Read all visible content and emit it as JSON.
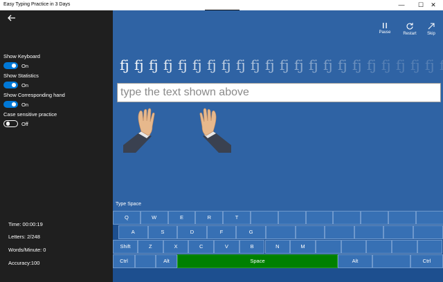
{
  "window": {
    "title": "Easy Typing Practice in 3 Days",
    "minimize": "—",
    "maximize": "☐",
    "close": "✕"
  },
  "sidebar": {
    "options": [
      {
        "label": "Show Keyboard",
        "state": "On",
        "on": true
      },
      {
        "label": "Show Statistics",
        "state": "On",
        "on": true
      },
      {
        "label": "Show Corresponding hand",
        "state": "On",
        "on": true
      },
      {
        "label": "Case sensitive practice",
        "state": "Off",
        "on": false
      }
    ],
    "stats": {
      "time": "Time: 00:00:19",
      "letters": "Letters: 2/248",
      "wpm": "Words/Minute: 0",
      "accuracy": "Accuracy:100"
    }
  },
  "toolbar": {
    "pause": "Pause",
    "restart": "Restart",
    "skip": "Skip"
  },
  "practice": {
    "words": [
      "fj",
      "fj",
      "fj",
      "fj",
      "fj",
      "fj",
      "fj",
      "fj",
      "fj",
      "fj",
      "fj",
      "fj",
      "fj",
      "fj",
      "fj",
      "fj",
      "fj",
      "fj",
      "fj",
      "fj",
      "fj",
      "fj",
      "fj"
    ],
    "input_placeholder": "type the text shown above"
  },
  "hint": "Type Space",
  "keyboard": {
    "row1": [
      "Q",
      "W",
      "E",
      "R",
      "T",
      "",
      "",
      "",
      "",
      "",
      "",
      ""
    ],
    "row2": [
      "A",
      "S",
      "D",
      "F",
      "G",
      "",
      "",
      "",
      "",
      "",
      ""
    ],
    "row3": [
      "Shift",
      "Z",
      "X",
      "C",
      "V",
      "B",
      "N",
      "M",
      "",
      "",
      "",
      "",
      ""
    ],
    "row4": {
      "ctrl_left": "Ctrl",
      "alt_left": "Alt",
      "space": "Space",
      "alt_right": "Alt",
      "ctrl_right": "Ctrl"
    }
  },
  "colors": {
    "sidebar": "#1f1f1f",
    "main": "#2f63a4",
    "accent": "#0078d7",
    "space_key": "#008000"
  }
}
